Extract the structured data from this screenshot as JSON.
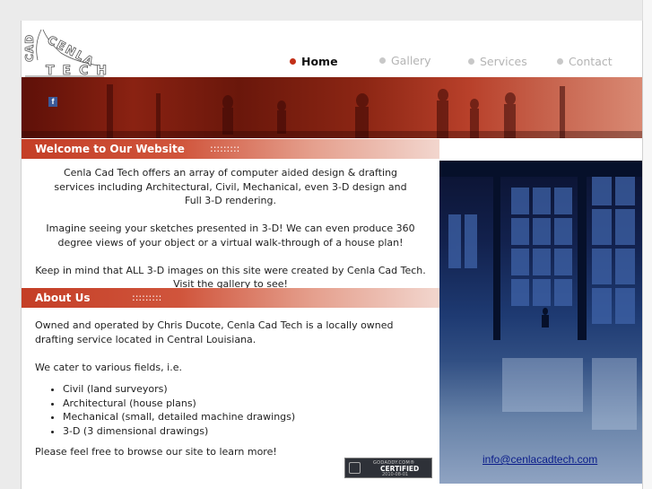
{
  "logo": {
    "line1": "CAD",
    "line2": "CENLA",
    "line3": "TECH"
  },
  "nav": [
    {
      "label": "Home",
      "active": true
    },
    {
      "label": "Gallery",
      "active": false
    },
    {
      "label": "Services",
      "active": false
    },
    {
      "label": "Contact",
      "active": false
    }
  ],
  "banner": {
    "facebook_glyph": "f"
  },
  "welcome": {
    "heading": "Welcome to Our Website",
    "dots": ":::::::::",
    "paragraphs": [
      "Cenla Cad Tech offers an array of computer aided design & drafting services including Architectural, Civil, Mechanical, even 3-D design and Full 3-D rendering.",
      "Imagine seeing your sketches presented in 3-D! We can even produce 360 degree views of your object or a virtual walk-through of a house plan!",
      "Keep in mind that ALL 3-D images on this site were created by Cenla Cad Tech.",
      "Visit the gallery to see!"
    ]
  },
  "about": {
    "heading": "About Us",
    "dots": ":::::::::",
    "intro": "Owned and operated by Chris Ducote, Cenla Cad Tech is a locally owned drafting service located in Central Louisiana.",
    "fields_intro": "We cater to various fields, i.e.",
    "fields": [
      "Civil (land surveyors)",
      "Architectural (house plans)",
      "Mechanical (small, detailed machine drawings)",
      "3-D (3 dimensional drawings)"
    ],
    "closing": "Please feel free to browse our site to learn more!"
  },
  "email": "info@cenlacadtech.com",
  "badge": {
    "line1": "GODADDY.COM®",
    "line2": "CERTIFIED",
    "line3": "2010-08-01"
  },
  "colors": {
    "accent": "#c23018",
    "banner_dark": "#5e1008",
    "photo_blue": "#1e3a72"
  }
}
